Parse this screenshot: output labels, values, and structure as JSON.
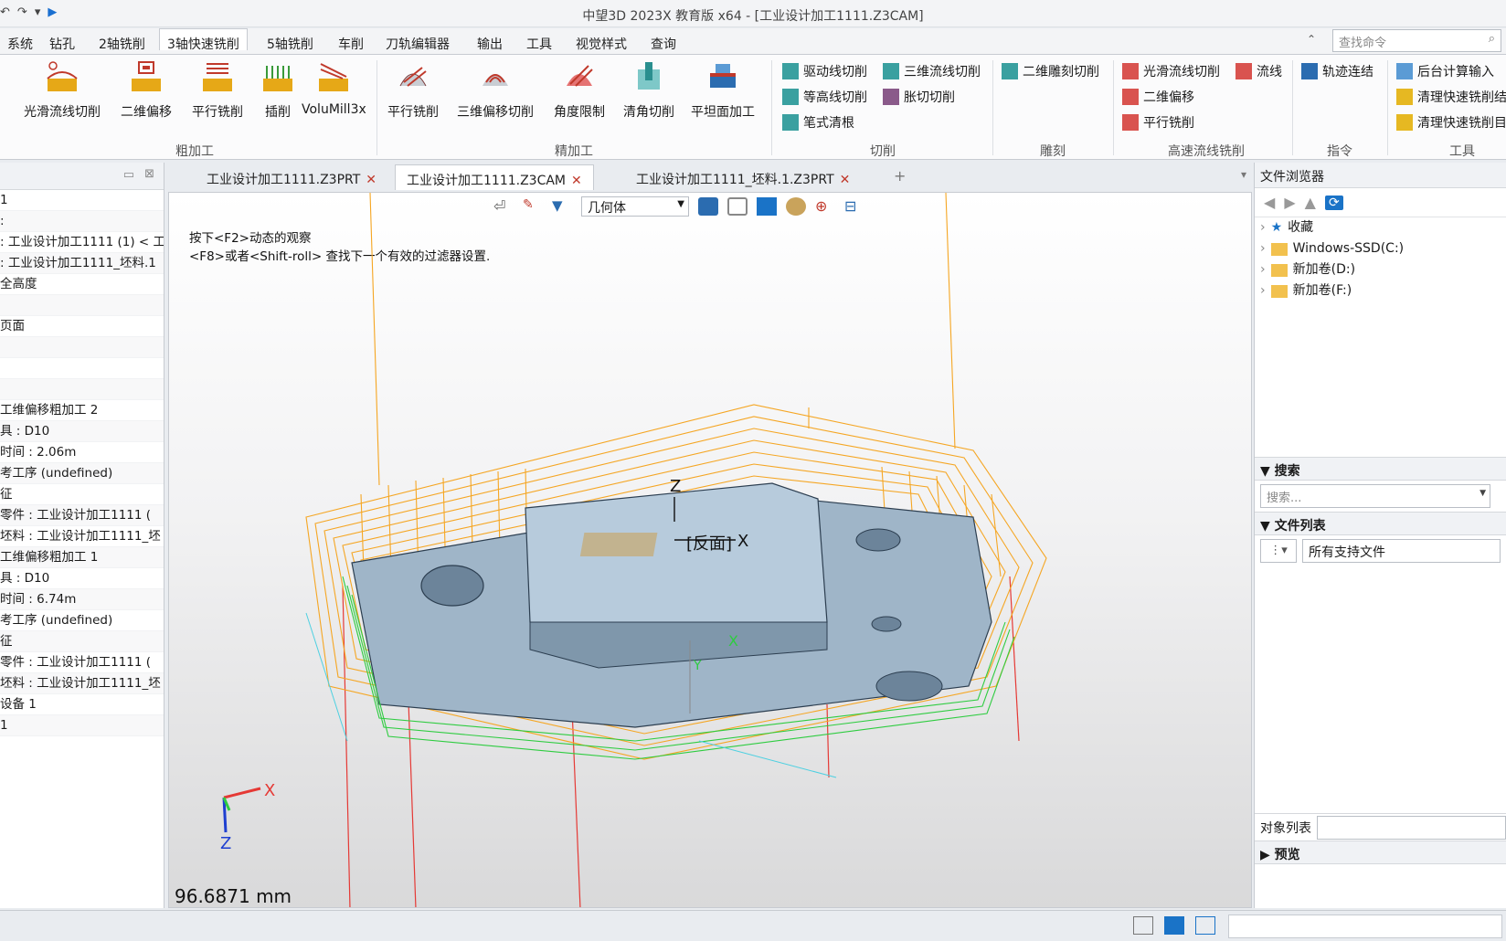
{
  "window": {
    "title": "中望3D 2023X 教育版 x64 - [工业设计加工1111.Z3CAM]"
  },
  "menus": [
    "系统",
    "钻孔",
    "2轴铣削",
    "3轴快速铣削",
    "5轴铣削",
    "车削",
    "刀轨编辑器",
    "输出",
    "工具",
    "视觉样式",
    "查询"
  ],
  "command_search": {
    "placeholder": "查找命令"
  },
  "ribbon": {
    "roughing": {
      "label": "粗加工",
      "buttons": [
        "光滑流线切削",
        "二维偏移",
        "平行铣削",
        "插削",
        "VoluMill3x"
      ]
    },
    "finishing": {
      "label": "精加工",
      "buttons": [
        "平行铣削",
        "三维偏移切削",
        "角度限制",
        "清角切削",
        "平坦面加工"
      ]
    },
    "cutting": {
      "label": "切削",
      "items": [
        "驱动线切削",
        "三维流线切削",
        "等高线切削",
        "胀切切削",
        "笔式清根"
      ]
    },
    "engraving": {
      "label": "雕刻",
      "items": [
        "二维雕刻切削"
      ]
    },
    "hs": {
      "label": "高速流线铣削",
      "items": [
        "光滑流线切削",
        "流线",
        "二维偏移",
        "平行铣削"
      ]
    },
    "command": {
      "label": "指令",
      "items": [
        "轨迹连结"
      ]
    },
    "tools": {
      "label": "工具",
      "items": [
        "后台计算输入",
        "清理快速铣削结",
        "清理快速铣削目"
      ]
    }
  },
  "doc_tabs": [
    "工业设计加工1111.Z3PRT",
    "工业设计加工1111.Z3CAM",
    "工业设计加工1111_坯料.1.Z3PRT"
  ],
  "tree_rows": [
    "1",
    ":",
    ": 工业设计加工1111 (1) < 工",
    ": 工业设计加工1111_坯料.1",
    "全高度",
    "",
    "页面",
    "",
    "",
    "",
    "工维偏移粗加工 2",
    "具 : D10",
    "时间 : 2.06m",
    "考工序 (undefined)",
    "征",
    "零件 : 工业设计加工1111 (",
    "坯料 : 工业设计加工1111_坯",
    "工维偏移粗加工 1",
    "具 : D10",
    "时间 : 6.74m",
    "考工序 (undefined)",
    "征",
    "零件 : 工业设计加工1111 (",
    "坯料 : 工业设计加工1111_坯",
    "设备 1",
    "1"
  ],
  "viewport": {
    "filter": "几何体",
    "hint_line1": "按下<F2>动态的观察",
    "hint_line2": "<F8>或者<Shift-roll> 查找下一个有效的过滤器设置.",
    "measure": "96.6871 mm",
    "face_label": "[反面]",
    "axis_x": "X",
    "axis_y": "Y",
    "axis_z": "Z"
  },
  "file_browser": {
    "title": "文件浏览器",
    "items": [
      "收藏",
      "Windows-SSD(C:)",
      "新加卷(D:)",
      "新加卷(F:)"
    ],
    "search_label": "搜索",
    "search_placeholder": "搜索...",
    "file_list_label": "文件列表",
    "file_filter": "所有支持文件",
    "object_list_label": "对象列表",
    "preview_label": "预览"
  }
}
